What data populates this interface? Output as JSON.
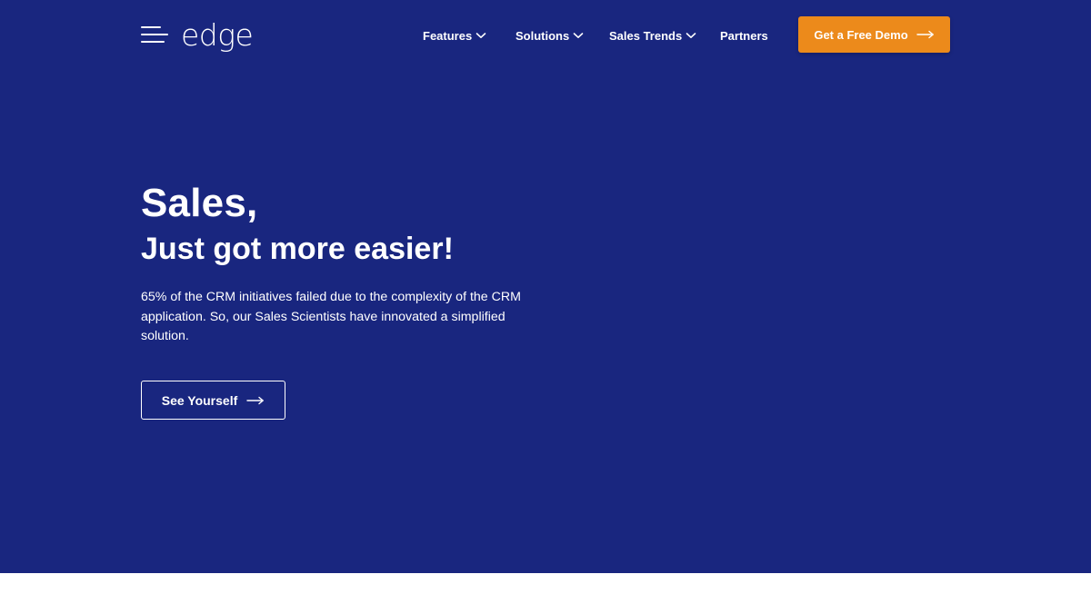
{
  "header": {
    "logo_text": "edge",
    "menu_icon": "hamburger-menu-icon",
    "nav": [
      {
        "label": "Features",
        "icon": "chevron-down-icon"
      },
      {
        "label": "Solutions",
        "icon": "chevron-down-icon"
      },
      {
        "label": "Sales Trends",
        "icon": "chevron-down-icon"
      },
      {
        "label": "Partners"
      }
    ],
    "demo_button": {
      "label": "Get a Free Demo",
      "icon": "arrow-right-icon"
    }
  },
  "hero": {
    "headline": "Sales,",
    "subheadline": "Just got more easier!",
    "description": "65% of the CRM initiatives failed due to the complexity of the CRM application. So, our Sales Scientists have innovated a simplified solution.",
    "cta": {
      "label": "See Yourself",
      "icon": "arrow-right-icon"
    }
  },
  "colors": {
    "hero_background": "#19267f",
    "accent": "#ec8a1b",
    "text": "#ffffff",
    "page_background": "#ffffff"
  }
}
